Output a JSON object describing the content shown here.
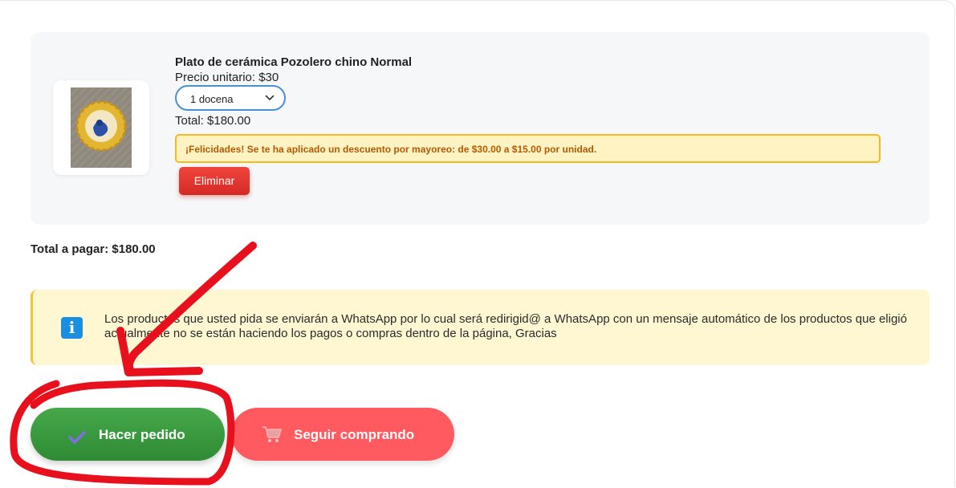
{
  "cart": {
    "items": [
      {
        "name": "Plato de cerámica Pozolero chino Normal",
        "unit_price": "Precio unitario: $30",
        "quantity_selected": "1 docena",
        "total": "Total: $180.00",
        "discount_message": "¡Felicidades! Se te ha aplicado un descuento por mayoreo: de $30.00 a $15.00 por unidad.",
        "delete_label": "Eliminar",
        "image_icon": "ceramic-plate-photo"
      }
    ],
    "grand_total": "Total a pagar: $180.00"
  },
  "notice": {
    "icon": "info-icon",
    "text": "Los productos que usted pida se enviarán a WhatsApp por lo cual será redirigid@ a WhatsApp con un mensaje automático de los productos que eligió actualmente no se están haciendo los pagos o compras dentro de la página, Gracias"
  },
  "actions": {
    "order_label": "Hacer pedido",
    "order_icon": "checkmark-icon",
    "continue_label": "Seguir comprando",
    "continue_icon": "cart-icon"
  },
  "colors": {
    "order_green": "#3a9a3f",
    "continue_red": "#ff5a5f",
    "delete_red": "#e2352e",
    "discount_border": "#f5b91e",
    "notice_bg": "#fff7d1",
    "annotation_red": "#e8101d"
  }
}
